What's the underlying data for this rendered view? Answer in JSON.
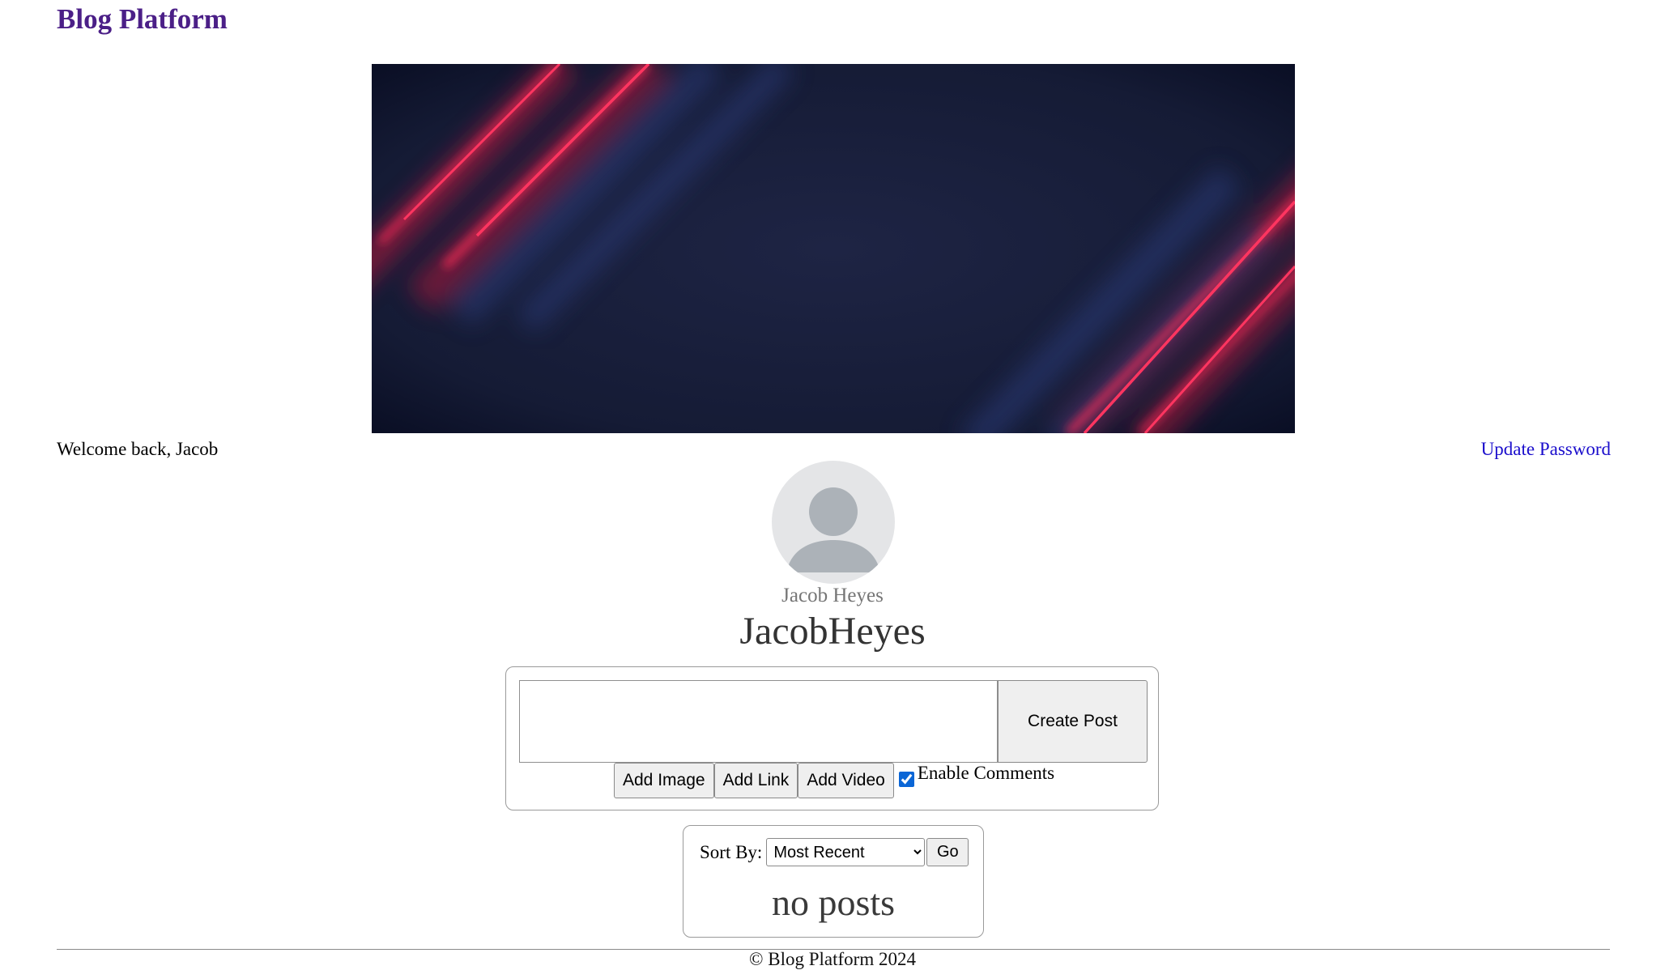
{
  "header": {
    "site_title": "Blog Platform"
  },
  "user_bar": {
    "welcome_text": "Welcome back, Jacob",
    "update_password_label": "Update Password"
  },
  "profile": {
    "full_name": "Jacob Heyes",
    "username": "JacobHeyes",
    "avatar_icon": "default-user-icon"
  },
  "composer": {
    "text_value": "",
    "create_post_label": "Create Post",
    "add_image_label": "Add Image",
    "add_link_label": "Add Link",
    "add_video_label": "Add Video",
    "enable_comments_label": "Enable Comments",
    "enable_comments_checked": true
  },
  "posts": {
    "sort_label": "Sort By:",
    "sort_selected": "Most Recent",
    "go_label": "Go",
    "empty_text": "no posts"
  },
  "footer": {
    "text": "© Blog Platform 2024"
  },
  "colors": {
    "title": "#4b1f87",
    "link": "#1a0dcc",
    "banner_bg": "#1b2140",
    "banner_stripe": "#ff2050",
    "checkbox": "#0a66d6"
  }
}
